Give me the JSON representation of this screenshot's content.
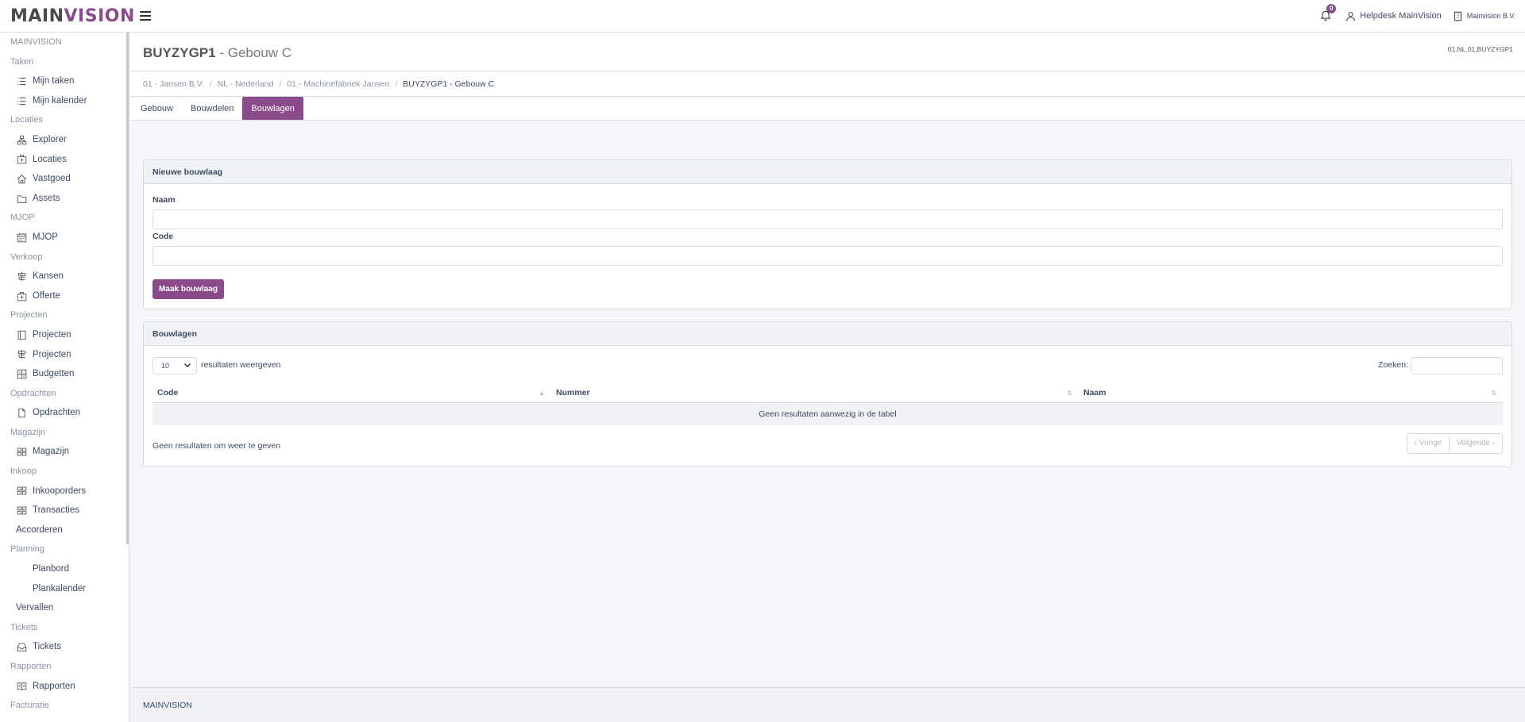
{
  "header": {
    "logo_main": "MAIN",
    "logo_accent": "VISION",
    "notification_count": "0",
    "user": "Helpdesk MainVision",
    "company": "Mainvision B.V."
  },
  "sidebar": {
    "sections": [
      {
        "title": "MAINVISION",
        "items": []
      },
      {
        "title": "Taken",
        "items": [
          {
            "label": "Mijn taken",
            "icon": "list-icon"
          },
          {
            "label": "Mijn kalender",
            "icon": "list-icon"
          }
        ]
      },
      {
        "title": "Locaties",
        "items": [
          {
            "label": "Explorer",
            "icon": "sitemap-icon"
          },
          {
            "label": "Locaties",
            "icon": "building-icon"
          },
          {
            "label": "Vastgoed",
            "icon": "home-icon"
          },
          {
            "label": "Assets",
            "icon": "folder-icon"
          }
        ]
      },
      {
        "title": "MJOP",
        "items": [
          {
            "label": "MJOP",
            "icon": "calendar-icon"
          }
        ]
      },
      {
        "title": "Verkoop",
        "items": [
          {
            "label": "Kansen",
            "icon": "signpost-icon"
          },
          {
            "label": "Offerte",
            "icon": "building-icon"
          }
        ]
      },
      {
        "title": "Projecten",
        "items": [
          {
            "label": "Projecten",
            "icon": "book-icon"
          },
          {
            "label": "Projecten",
            "icon": "signpost-icon"
          },
          {
            "label": "Budgetten",
            "icon": "ledger-icon"
          }
        ]
      },
      {
        "title": "Opdrachten",
        "items": [
          {
            "label": "Opdrachten",
            "icon": "document-icon"
          }
        ]
      },
      {
        "title": "Magazijn",
        "items": [
          {
            "label": "Magazijn",
            "icon": "grid-icon"
          }
        ]
      },
      {
        "title": "Inkoop",
        "items": [
          {
            "label": "Inkooporders",
            "icon": "grid-icon"
          },
          {
            "label": "Transacties",
            "icon": "grid-icon"
          },
          {
            "label": "Accorderen",
            "icon": ""
          }
        ]
      },
      {
        "title": "Planning",
        "items": [
          {
            "label": "Planbord",
            "icon": "none"
          },
          {
            "label": "Plankalender",
            "icon": "none"
          },
          {
            "label": "Vervallen",
            "icon": ""
          }
        ]
      },
      {
        "title": "Tickets",
        "items": [
          {
            "label": "Tickets",
            "icon": "inbox-icon"
          }
        ]
      },
      {
        "title": "Rapporten",
        "items": [
          {
            "label": "Rapporten",
            "icon": "report-icon"
          }
        ]
      },
      {
        "title": "Facturatie",
        "items": []
      }
    ]
  },
  "page": {
    "code": "BUYZYGP1",
    "title_sep": " - ",
    "name": "Gebouw C",
    "reference": "01.NL.01.BUYZYGP1"
  },
  "breadcrumb": [
    "01 - Jansen B.V.",
    "NL - Nederland",
    "01 - Machinefabriek Jansen",
    "BUYZYGP1 - Gebouw C"
  ],
  "tabs": [
    {
      "label": "Gebouw",
      "active": false
    },
    {
      "label": "Bouwdelen",
      "active": false
    },
    {
      "label": "Bouwlagen",
      "active": true
    }
  ],
  "form": {
    "title": "Nieuwe bouwlaag",
    "name_label": "Naam",
    "code_label": "Code",
    "submit_label": "Maak bouwlaag"
  },
  "list": {
    "title": "Bouwlagen",
    "page_length": "10",
    "length_suffix": "resultaten weergeven",
    "search_label": "Zoeken:",
    "columns": [
      "Code",
      "Nummer",
      "Naam"
    ],
    "empty_message": "Geen resultaten aanwezig in de tabel",
    "info": "Geen resultaten om weer te geven",
    "prev_label": "‹ Vorige",
    "next_label": "Volgende ›"
  },
  "footer": {
    "text": "MAINVISION"
  },
  "colors": {
    "accent": "#8b4a8c",
    "text": "#3c4b64",
    "muted": "#8a93a2"
  }
}
